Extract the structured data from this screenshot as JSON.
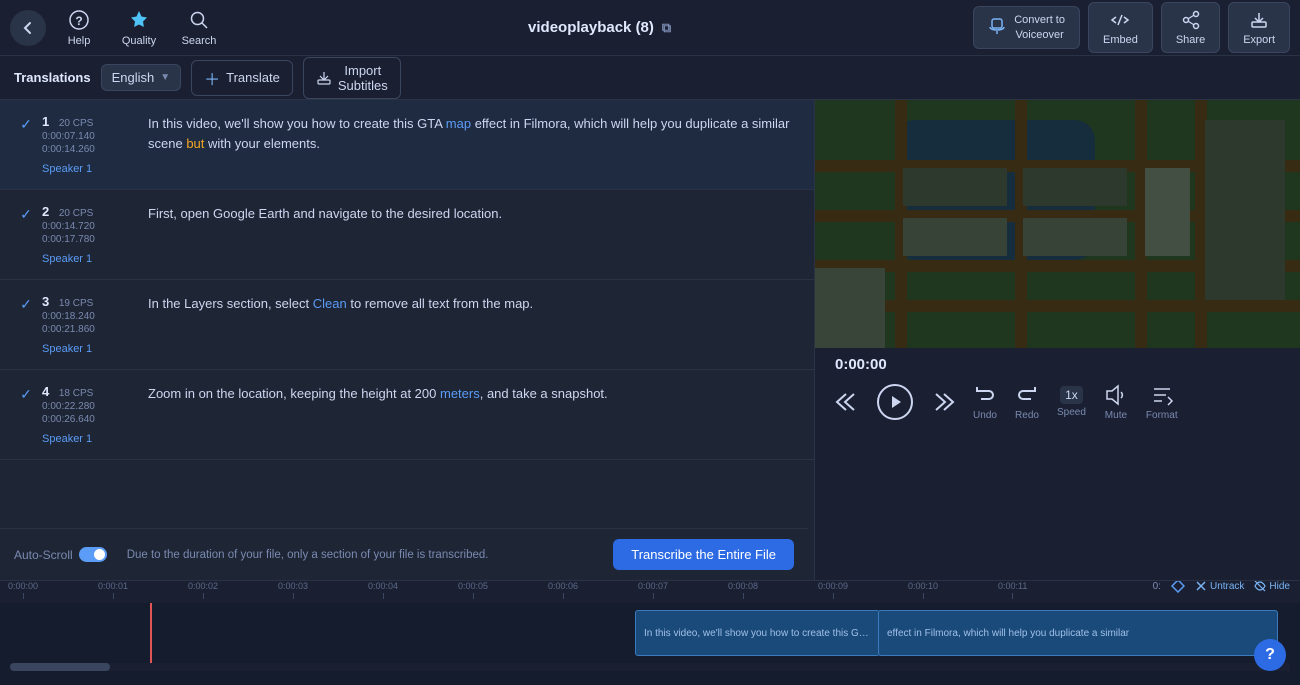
{
  "topbar": {
    "back_label": "←",
    "help_label": "Help",
    "quality_label": "Quality",
    "search_label": "Search",
    "title": "videoplayback (8)",
    "ext_link": "⧉",
    "convert_label": "Convert to\nVoiceover",
    "embed_label": "Embed",
    "share_label": "Share",
    "export_label": "Export"
  },
  "subtitle_toolbar": {
    "translations_label": "Translations",
    "lang_label": "English",
    "translate_btn_label": "Translate",
    "import_btn_label": "Import\nSubtitles"
  },
  "subtitles": [
    {
      "id": 1,
      "cps": "20 CPS",
      "time_start": "0:00:07.140",
      "time_end": "0:00:14.260",
      "speaker": "Speaker 1",
      "text": "In this video, we'll show you how to create this GTA map effect in Filmora, which will help you duplicate a similar scene but with your elements.",
      "highlights": [
        {
          "word": "map",
          "color": "blue"
        },
        {
          "word": "but",
          "color": "orange"
        }
      ]
    },
    {
      "id": 2,
      "cps": "20 CPS",
      "time_start": "0:00:14.720",
      "time_end": "0:00:17.780",
      "speaker": "Speaker 1",
      "text": "First, open Google Earth and navigate to the desired location.",
      "highlights": []
    },
    {
      "id": 3,
      "cps": "19 CPS",
      "time_start": "0:00:18.240",
      "time_end": "0:00:21.860",
      "speaker": "Speaker 1",
      "text": "In the Layers section, select Clean to remove all text from the map.",
      "highlights": [
        {
          "word": "Clean",
          "color": "blue"
        }
      ]
    },
    {
      "id": 4,
      "cps": "18 CPS",
      "time_start": "0:00:22.280",
      "time_end": "0:00:26.640",
      "speaker": "Speaker 1",
      "text": "Zoom in on the location, keeping the height at 200 meters, and take a snapshot.",
      "highlights": [
        {
          "word": "meters",
          "color": "blue"
        }
      ]
    }
  ],
  "transcribe_bar": {
    "notice": "Due to the duration of your file, only a section of your file is transcribed.",
    "button_label": "Transcribe the Entire File",
    "auto_scroll_label": "Auto-Scroll"
  },
  "video": {
    "time": "0:00:00",
    "controls": {
      "rewind_label": "",
      "play_label": "",
      "forward_label": "",
      "undo_label": "Undo",
      "redo_label": "Redo",
      "speed_label": "Speed",
      "speed_value": "1x",
      "mute_label": "Mute",
      "format_label": "Format"
    }
  },
  "timeline": {
    "ticks": [
      "0:00:00",
      "0:00:01",
      "0:00:02",
      "0:00:03",
      "0:00:04",
      "0:00:05",
      "0:00:06",
      "0:00:07",
      "0:00:08",
      "0:00:09",
      "0:00:10",
      "0:00:11"
    ],
    "clip1_text": "In this video, we'll show you how to create this GTA map",
    "clip2_text": "effect in Filmora, which will help you duplicate a similar",
    "time_label": "0:",
    "untrack_label": "Untrack",
    "hide_label": "Hide"
  },
  "help_btn": "?"
}
